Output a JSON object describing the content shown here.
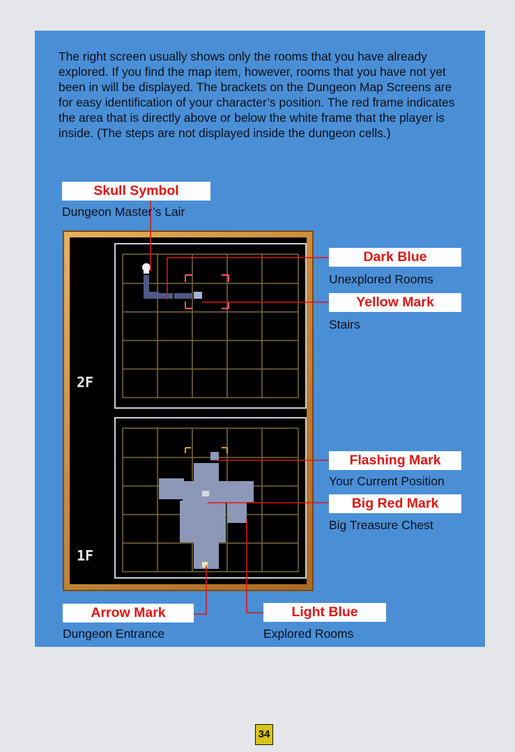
{
  "intro": "The right screen usually shows only the rooms that you have already explored. If you find the map item, however, rooms that you have not yet been in will be displayed. The brackets on the Dungeon Map Screens are for easy identification of your character’s position. The red frame indicates the area that is directly above or below the white frame that the player is inside. (The steps are not displayed inside the dungeon cells.)",
  "callouts": {
    "skull": {
      "label": "Skull Symbol",
      "desc": "Dungeon Master’s Lair"
    },
    "dark_blue": {
      "label": "Dark Blue",
      "desc": "Unexplored Rooms"
    },
    "yellow": {
      "label": "Yellow Mark",
      "desc": "Stairs"
    },
    "flashing": {
      "label": "Flashing Mark",
      "desc": "Your Current Position"
    },
    "big_red": {
      "label": "Big Red Mark",
      "desc": "Big Treasure Chest"
    },
    "arrow": {
      "label": "Arrow Mark",
      "desc": "Dungeon Entrance"
    },
    "light_blue": {
      "label": "Light Blue",
      "desc": "Explored Rooms"
    }
  },
  "map": {
    "floor_upper": "2F",
    "floor_lower": "1F"
  },
  "colors": {
    "panel": "#4a8fd6",
    "label_text": "#e01414",
    "leader_line": "#e01414",
    "explored_room": "#8d97b8",
    "unexplored_room": "#4e5a86",
    "frame_gold": "#c98a3a"
  },
  "page_number": "34"
}
